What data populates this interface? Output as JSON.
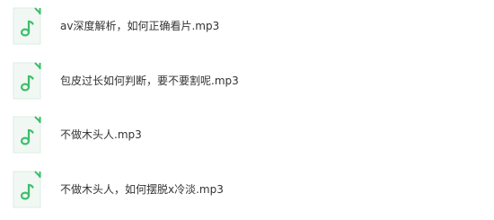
{
  "files": [
    {
      "name": "av深度解析，如何正确看片.mp3",
      "icon": "music-file-icon"
    },
    {
      "name": "包皮过长如何判断，要不要割呢.mp3",
      "icon": "music-file-icon"
    },
    {
      "name": "不做木头人.mp3",
      "icon": "music-file-icon"
    },
    {
      "name": "不做木头人，如何摆脱x冷淡.mp3",
      "icon": "music-file-icon"
    }
  ],
  "colors": {
    "icon_background": "#f1f8f3",
    "icon_border": "#dbeee1",
    "icon_accent": "#3bbf6a",
    "text": "#333333"
  }
}
